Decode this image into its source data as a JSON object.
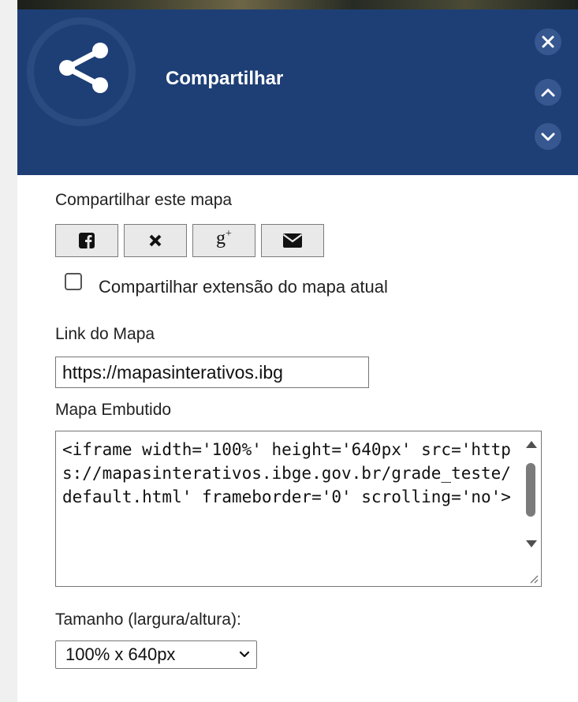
{
  "header": {
    "title": "Compartilhar",
    "icon": "share-icon",
    "buttons": [
      "close-icon",
      "chevron-up-icon",
      "chevron-down-icon"
    ],
    "colors": {
      "background": "#1e3f75",
      "button": "#36578f"
    }
  },
  "share": {
    "label": "Compartilhar este mapa",
    "buttons": [
      "facebook-icon",
      "x-icon",
      "google-plus-icon",
      "envelope-icon"
    ],
    "gplus_text": "g",
    "gplus_sup": "+"
  },
  "extent_checkbox": {
    "label": "Compartilhar extensão do mapa atual",
    "checked": false
  },
  "map_link": {
    "label": "Link do Mapa",
    "value": "https://mapasinterativos.ibg"
  },
  "embed": {
    "label": "Mapa Embutido",
    "code": "<iframe width='100%' height='640px' src='https://mapasinterativos.ibge.gov.br/grade_teste/default.html' frameborder='0' scrolling='no'>"
  },
  "size": {
    "label": "Tamanho (largura/altura):",
    "selected": "100% x 640px"
  }
}
